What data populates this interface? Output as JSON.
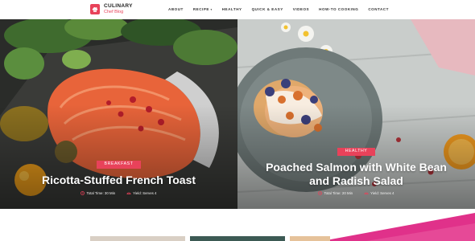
{
  "brand": {
    "title": "CULINARY",
    "subtitle": "Chef Blog"
  },
  "nav": [
    {
      "label": "ABOUT"
    },
    {
      "label": "RECIPE",
      "has_dropdown": true
    },
    {
      "label": "HEALTHY"
    },
    {
      "label": "QUICK & EASY"
    },
    {
      "label": "VIDEOS"
    },
    {
      "label": "HOW-TO COOKING"
    },
    {
      "label": "CONTACT"
    }
  ],
  "posts": [
    {
      "category": "BREAKFAST",
      "title": "Ricotta-Stuffed French Toast",
      "time": "Total Time: 30 Min",
      "yield": "Yield: Serves 4"
    },
    {
      "category": "HEALTHY",
      "title_line1": "Poached Salmon with White Bean",
      "title_line2": "and Radish Salad",
      "time": "Total Time: 20 Min",
      "yield": "Yield: Serves 4"
    }
  ],
  "colors": {
    "accent": "#e8425a",
    "text_dark": "#1f1f1f",
    "accent_pink": "#e0318a"
  }
}
